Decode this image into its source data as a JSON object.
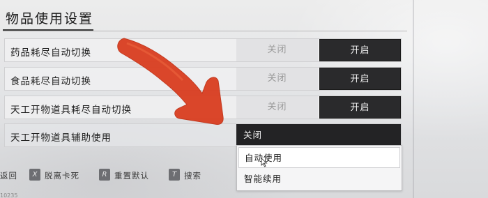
{
  "page": {
    "title": "物品使用设置"
  },
  "rows": [
    {
      "label": "药品耗尽自动切换",
      "off_label": "关闭",
      "on_label": "开启",
      "state": "on"
    },
    {
      "label": "食品耗尽自动切换",
      "off_label": "关闭",
      "on_label": "开启",
      "state": "on"
    },
    {
      "label": "天工开物道具耗尽自动切换",
      "off_label": "关闭",
      "on_label": "开启",
      "state": "on"
    }
  ],
  "dropdown_row": {
    "label": "天工开物道具辅助使用",
    "selected": "关闭",
    "options": [
      "自动使用",
      "智能续用"
    ],
    "hovered_option": "自动使用"
  },
  "footer": {
    "back_label": "返回",
    "unstuck_key": "X",
    "unstuck_label": "脱离卡死",
    "reset_key": "R",
    "reset_label": "重置默认",
    "search_key": "T",
    "search_label": "搜索"
  },
  "corner_text": "10235",
  "colors": {
    "annotation_arrow": "#d93a1c",
    "toggle_on_bg": "#2a2a2c",
    "toggle_off_bg": "#e2e2e4"
  },
  "icons": {
    "cursor": "mouse-pointer-icon",
    "annotation": "red-arrow-annotation-icon"
  }
}
